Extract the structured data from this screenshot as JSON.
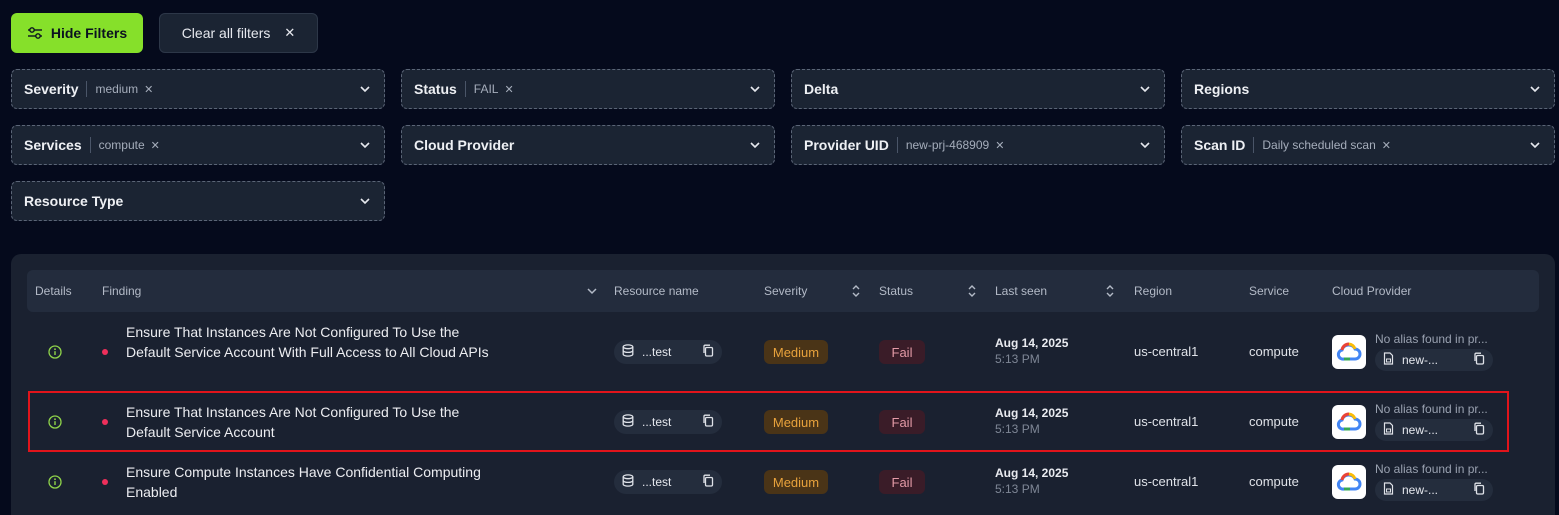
{
  "toolbar": {
    "hide_filters_label": "Hide Filters",
    "clear_filters_label": "Clear all filters",
    "clear_icon": "close-icon",
    "hide_icon": "sliders-icon"
  },
  "filters": [
    {
      "label": "Severity",
      "value": "medium"
    },
    {
      "label": "Status",
      "value": "FAIL"
    },
    {
      "label": "Delta",
      "value": null
    },
    {
      "label": "Regions",
      "value": null
    },
    {
      "label": "Services",
      "value": "compute"
    },
    {
      "label": "Cloud Provider",
      "value": null
    },
    {
      "label": "Provider UID",
      "value": "new-prj-468909"
    },
    {
      "label": "Scan ID",
      "value": "Daily scheduled scan"
    },
    {
      "label": "Resource Type",
      "value": null
    }
  ],
  "table": {
    "columns": {
      "details": "Details",
      "finding": "Finding",
      "resource": "Resource name",
      "severity": "Severity",
      "status": "Status",
      "last_seen": "Last seen",
      "region": "Region",
      "service": "Service",
      "cloud_provider": "Cloud Provider"
    },
    "rows": [
      {
        "finding": "Ensure That Instances Are Not Configured To Use the Default Service Account With Full Access to All Cloud APIs",
        "resource": "...test",
        "severity": "Medium",
        "status": "Fail",
        "date": "Aug 14, 2025",
        "time": "5:13 PM",
        "region": "us-central1",
        "service": "compute",
        "alias": "No alias found in pr...",
        "uid": "new-..."
      },
      {
        "finding": "Ensure That Instances Are Not Configured To Use the Default Service Account",
        "resource": "...test",
        "severity": "Medium",
        "status": "Fail",
        "date": "Aug 14, 2025",
        "time": "5:13 PM",
        "region": "us-central1",
        "service": "compute",
        "alias": "No alias found in pr...",
        "uid": "new-..."
      },
      {
        "finding": "Ensure Compute Instances Have Confidential Computing Enabled",
        "resource": "...test",
        "severity": "Medium",
        "status": "Fail",
        "date": "Aug 14, 2025",
        "time": "5:13 PM",
        "region": "us-central1",
        "service": "compute",
        "alias": "No alias found in pr...",
        "uid": "new-..."
      }
    ]
  },
  "colors": {
    "accent": "#86e02a",
    "background": "#050a1c",
    "highlight": "#e1141b"
  }
}
